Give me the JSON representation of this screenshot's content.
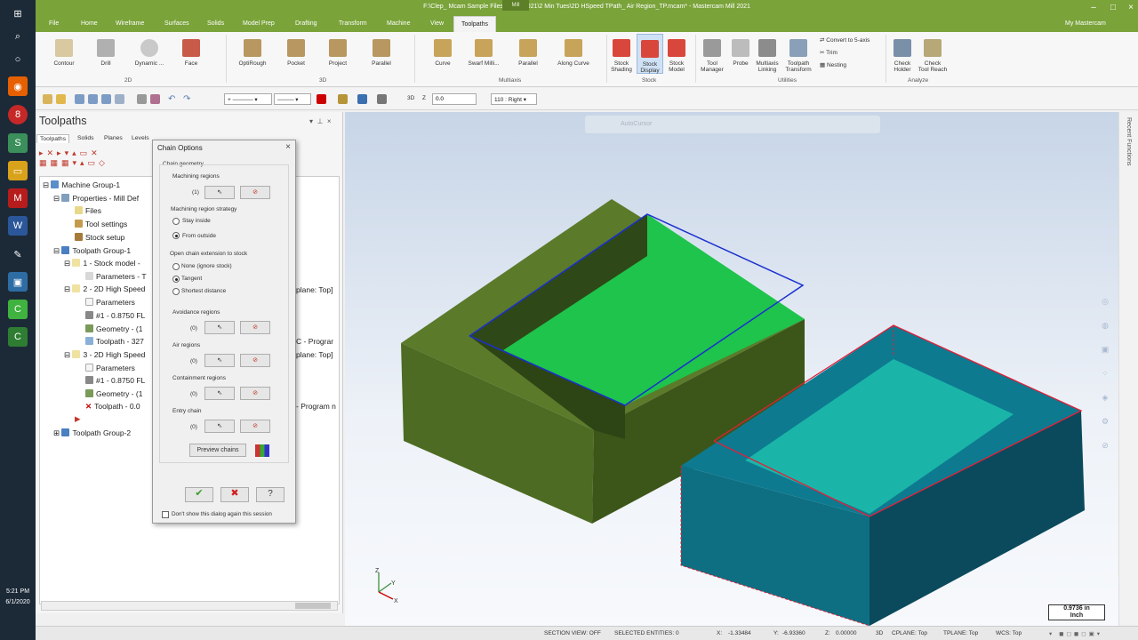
{
  "window": {
    "title": "F:\\Clep_ Mcam Sample Files\\Mcam 2021\\2 Min Tues\\2D HSpeed TPath_ Air Region_TP.mcam* - Mastercam Mill 2021",
    "context_tab": "Mill",
    "account": "My Mastercam"
  },
  "menu": [
    "File",
    "Home",
    "Wireframe",
    "Surfaces",
    "Solids",
    "Model Prep",
    "Drafting",
    "Transform",
    "Machine",
    "View",
    "Toolpaths"
  ],
  "ribbon": {
    "buttons_2d": [
      "Contour",
      "Drill",
      "Dynamic ...",
      "Face"
    ],
    "buttons_3d": [
      "OptiRough",
      "Pocket",
      "Project",
      "Parallel"
    ],
    "buttons_multiaxis": [
      "Curve",
      "Swarf Milli...",
      "Parallel",
      "Along Curve"
    ],
    "buttons_stock": [
      [
        "Stock",
        "Shading"
      ],
      [
        "Stock",
        "Display"
      ],
      [
        "Stock",
        "Model"
      ]
    ],
    "buttons_utilities": [
      [
        "Tool",
        "Manager"
      ],
      [
        "Probe",
        ""
      ],
      [
        "Multiaxis",
        "Linking"
      ],
      [
        "Toolpath",
        "Transform"
      ]
    ],
    "utility_small": [
      "Convert to 5-axis",
      "Trim",
      "Nesting"
    ],
    "buttons_analyze": [
      [
        "Check",
        "Holder"
      ],
      [
        "Check",
        "Tool Reach"
      ]
    ],
    "groups": [
      "2D",
      "3D",
      "Multiaxis",
      "Stock",
      "Utilities",
      "Analyze"
    ]
  },
  "qat": {
    "z_label": "Z",
    "z_value": "0.0",
    "view": "110 : Right",
    "dim": "3D"
  },
  "panel": {
    "title": "Toolpaths",
    "tabs": [
      "Toolpaths",
      "Solids",
      "Planes",
      "Levels"
    ],
    "tree": [
      {
        "text": "Machine Group-1",
        "indent": 0
      },
      {
        "text": "Properties - Mill Def",
        "indent": 1
      },
      {
        "text": "Files",
        "indent": 2
      },
      {
        "text": "Tool settings",
        "indent": 2
      },
      {
        "text": "Stock setup",
        "indent": 2
      },
      {
        "text": "Toolpath Group-1",
        "indent": 1
      },
      {
        "text": "1 - Stock model - ",
        "indent": 2
      },
      {
        "text": "Parameters - T",
        "indent": 3
      },
      {
        "text": "2 - 2D High Speed",
        "indent": 2
      },
      {
        "text": "Parameters",
        "indent": 3
      },
      {
        "text": "#1 - 0.8750 FL",
        "indent": 3
      },
      {
        "text": "Geometry - (1",
        "indent": 3
      },
      {
        "text": "Toolpath - 327",
        "indent": 3
      },
      {
        "text": "3 - 2D High Speed",
        "indent": 2
      },
      {
        "text": "Parameters",
        "indent": 3
      },
      {
        "text": "#1 - 0.8750 FL",
        "indent": 3
      },
      {
        "text": "Geometry - (1",
        "indent": 3
      },
      {
        "text": "Toolpath - 0.0",
        "indent": 3
      },
      {
        "text": "",
        "indent": 3
      },
      {
        "text": "Toolpath Group-2",
        "indent": 1
      }
    ],
    "clipped_right": [
      "plane: Top]",
      "C - Prograr",
      "plane: Top]",
      "- Program n"
    ]
  },
  "dialog": {
    "title": "Chain Options",
    "chain_geometry": "Chain geometry",
    "machining_regions": "Machining regions",
    "machining_count": "(1)",
    "strategy_label": "Machining region strategy",
    "strategy_options": [
      "Stay inside",
      "From outside"
    ],
    "open_chain_label": "Open chain extension to stock",
    "open_chain_options": [
      "None (ignore stock)",
      "Tangent",
      "Shortest distance"
    ],
    "avoidance": "Avoidance regions",
    "avoidance_count": "(0)",
    "air": "Air regions",
    "air_count": "(0)",
    "containment": "Containment regions",
    "containment_count": "(0)",
    "entry": "Entry chain",
    "entry_count": "(0)",
    "preview": "Preview chains",
    "dont_show": "Don't show this dialog again this session"
  },
  "viewport": {
    "autocursor": "AutoCursor",
    "scale": [
      "0.9736 in",
      "Inch"
    ],
    "side_tab": "Recent Functions"
  },
  "status": {
    "section": "SECTION VIEW: OFF",
    "selected": "SELECTED ENTITIES: 0",
    "x_label": "X:",
    "x": "-1.33484",
    "y_label": "Y:",
    "y": "-6.93360",
    "z_label": "Z:",
    "z": "0.00000",
    "dim": "3D",
    "cplane": "CPLANE: Top",
    "tplane": "TPLANE: Top",
    "wcs": "WCS: Top"
  },
  "taskbar": {
    "time": "5:21 PM",
    "date": "6/1/2020"
  }
}
